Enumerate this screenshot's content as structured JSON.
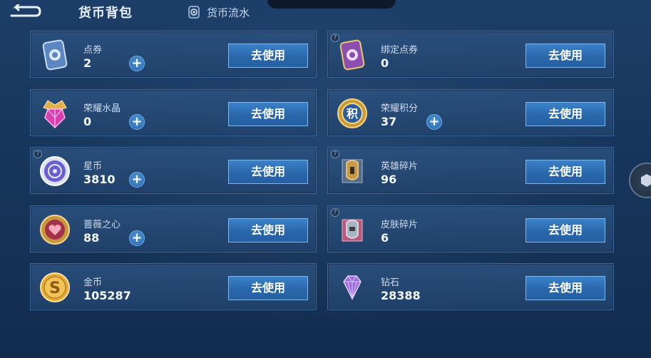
{
  "header": {
    "title": "货币背包",
    "flow_tab_label": "货币流水",
    "back_icon": "back-arrow-icon"
  },
  "currencies": [
    {
      "name": "点券",
      "amount": "2",
      "has_plus": true,
      "icon": "voucher-card-icon",
      "button": "去使用"
    },
    {
      "name": "绑定点券",
      "amount": "0",
      "has_plus": false,
      "has_help": true,
      "icon": "bound-voucher-card-icon",
      "button": "去使用"
    },
    {
      "name": "荣耀水晶",
      "amount": "0",
      "has_plus": true,
      "icon": "glory-crystal-icon",
      "button": "去使用"
    },
    {
      "name": "荣耀积分",
      "amount": "37",
      "has_plus": true,
      "icon": "glory-points-icon",
      "button": "去使用"
    },
    {
      "name": "星币",
      "amount": "3810",
      "has_plus": true,
      "has_help": true,
      "icon": "star-coin-icon",
      "button": "去使用"
    },
    {
      "name": "英雄碎片",
      "amount": "96",
      "has_plus": false,
      "has_help": true,
      "icon": "hero-fragment-icon",
      "button": "去使用"
    },
    {
      "name": "蔷薇之心",
      "amount": "88",
      "has_plus": true,
      "icon": "rose-heart-icon",
      "button": "去使用"
    },
    {
      "name": "皮肤碎片",
      "amount": "6",
      "has_plus": false,
      "has_help": true,
      "icon": "skin-fragment-icon",
      "button": "去使用"
    },
    {
      "name": "金币",
      "amount": "105287",
      "has_plus": false,
      "icon": "gold-coin-icon",
      "button": "去使用"
    },
    {
      "name": "钻石",
      "amount": "28388",
      "has_plus": false,
      "icon": "diamond-icon",
      "button": "去使用"
    }
  ],
  "colors": {
    "background": "#17355b",
    "card": "#2c5280",
    "button": "#2a67ab",
    "button_border": "#7db7ee"
  }
}
